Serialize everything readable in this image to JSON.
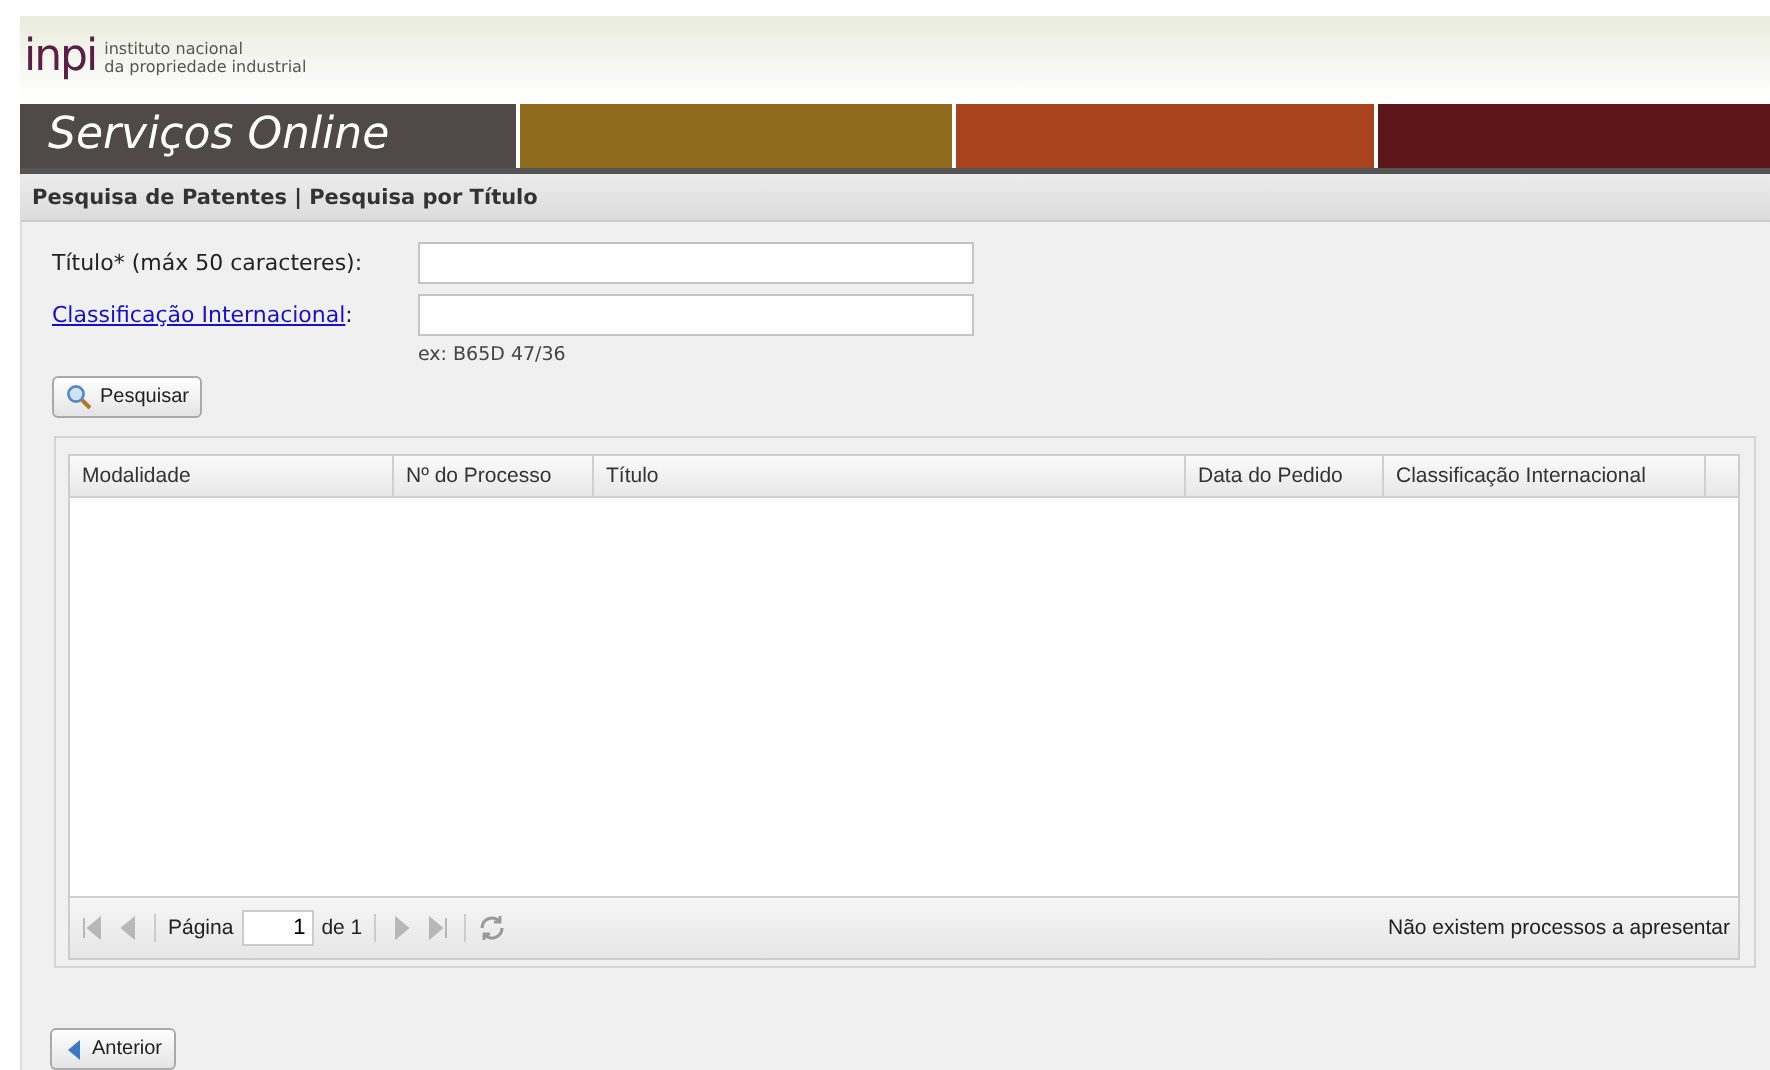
{
  "logo": {
    "mark": "inpi",
    "line_1": "instituto nacional",
    "line_2": "da propriedade industrial"
  },
  "banner": {
    "title": "Serviços Online",
    "stripes": [
      {
        "color": "#8e6a1c"
      },
      {
        "color": "#a8431e"
      },
      {
        "color": "#5e161b"
      }
    ]
  },
  "breadcrumb": "Pesquisa de Patentes | Pesquisa por Título",
  "form": {
    "fields": [
      {
        "kind": "label",
        "label": "Título* (máx 50 caracteres):"
      },
      {
        "kind": "link",
        "label": "Classificação Internacional",
        "suffix": ":",
        "hint": "ex: B65D 47/36"
      }
    ],
    "search_button": "Pesquisar"
  },
  "table": {
    "columns": [
      "Modalidade",
      "Nº do Processo",
      "Título",
      "Data do Pedido",
      "Classificação Internacional"
    ]
  },
  "pager": {
    "nav_before": [
      {
        "kind": "first",
        "disabled": true
      },
      {
        "kind": "prev",
        "disabled": true
      }
    ],
    "page_label": "Página",
    "page_value": "1",
    "of_label": "de 1",
    "nav_after": [
      {
        "kind": "next",
        "disabled": true
      },
      {
        "kind": "last",
        "disabled": true
      }
    ],
    "status": "Não existem processos a apresentar"
  },
  "back_button": "Anterior"
}
